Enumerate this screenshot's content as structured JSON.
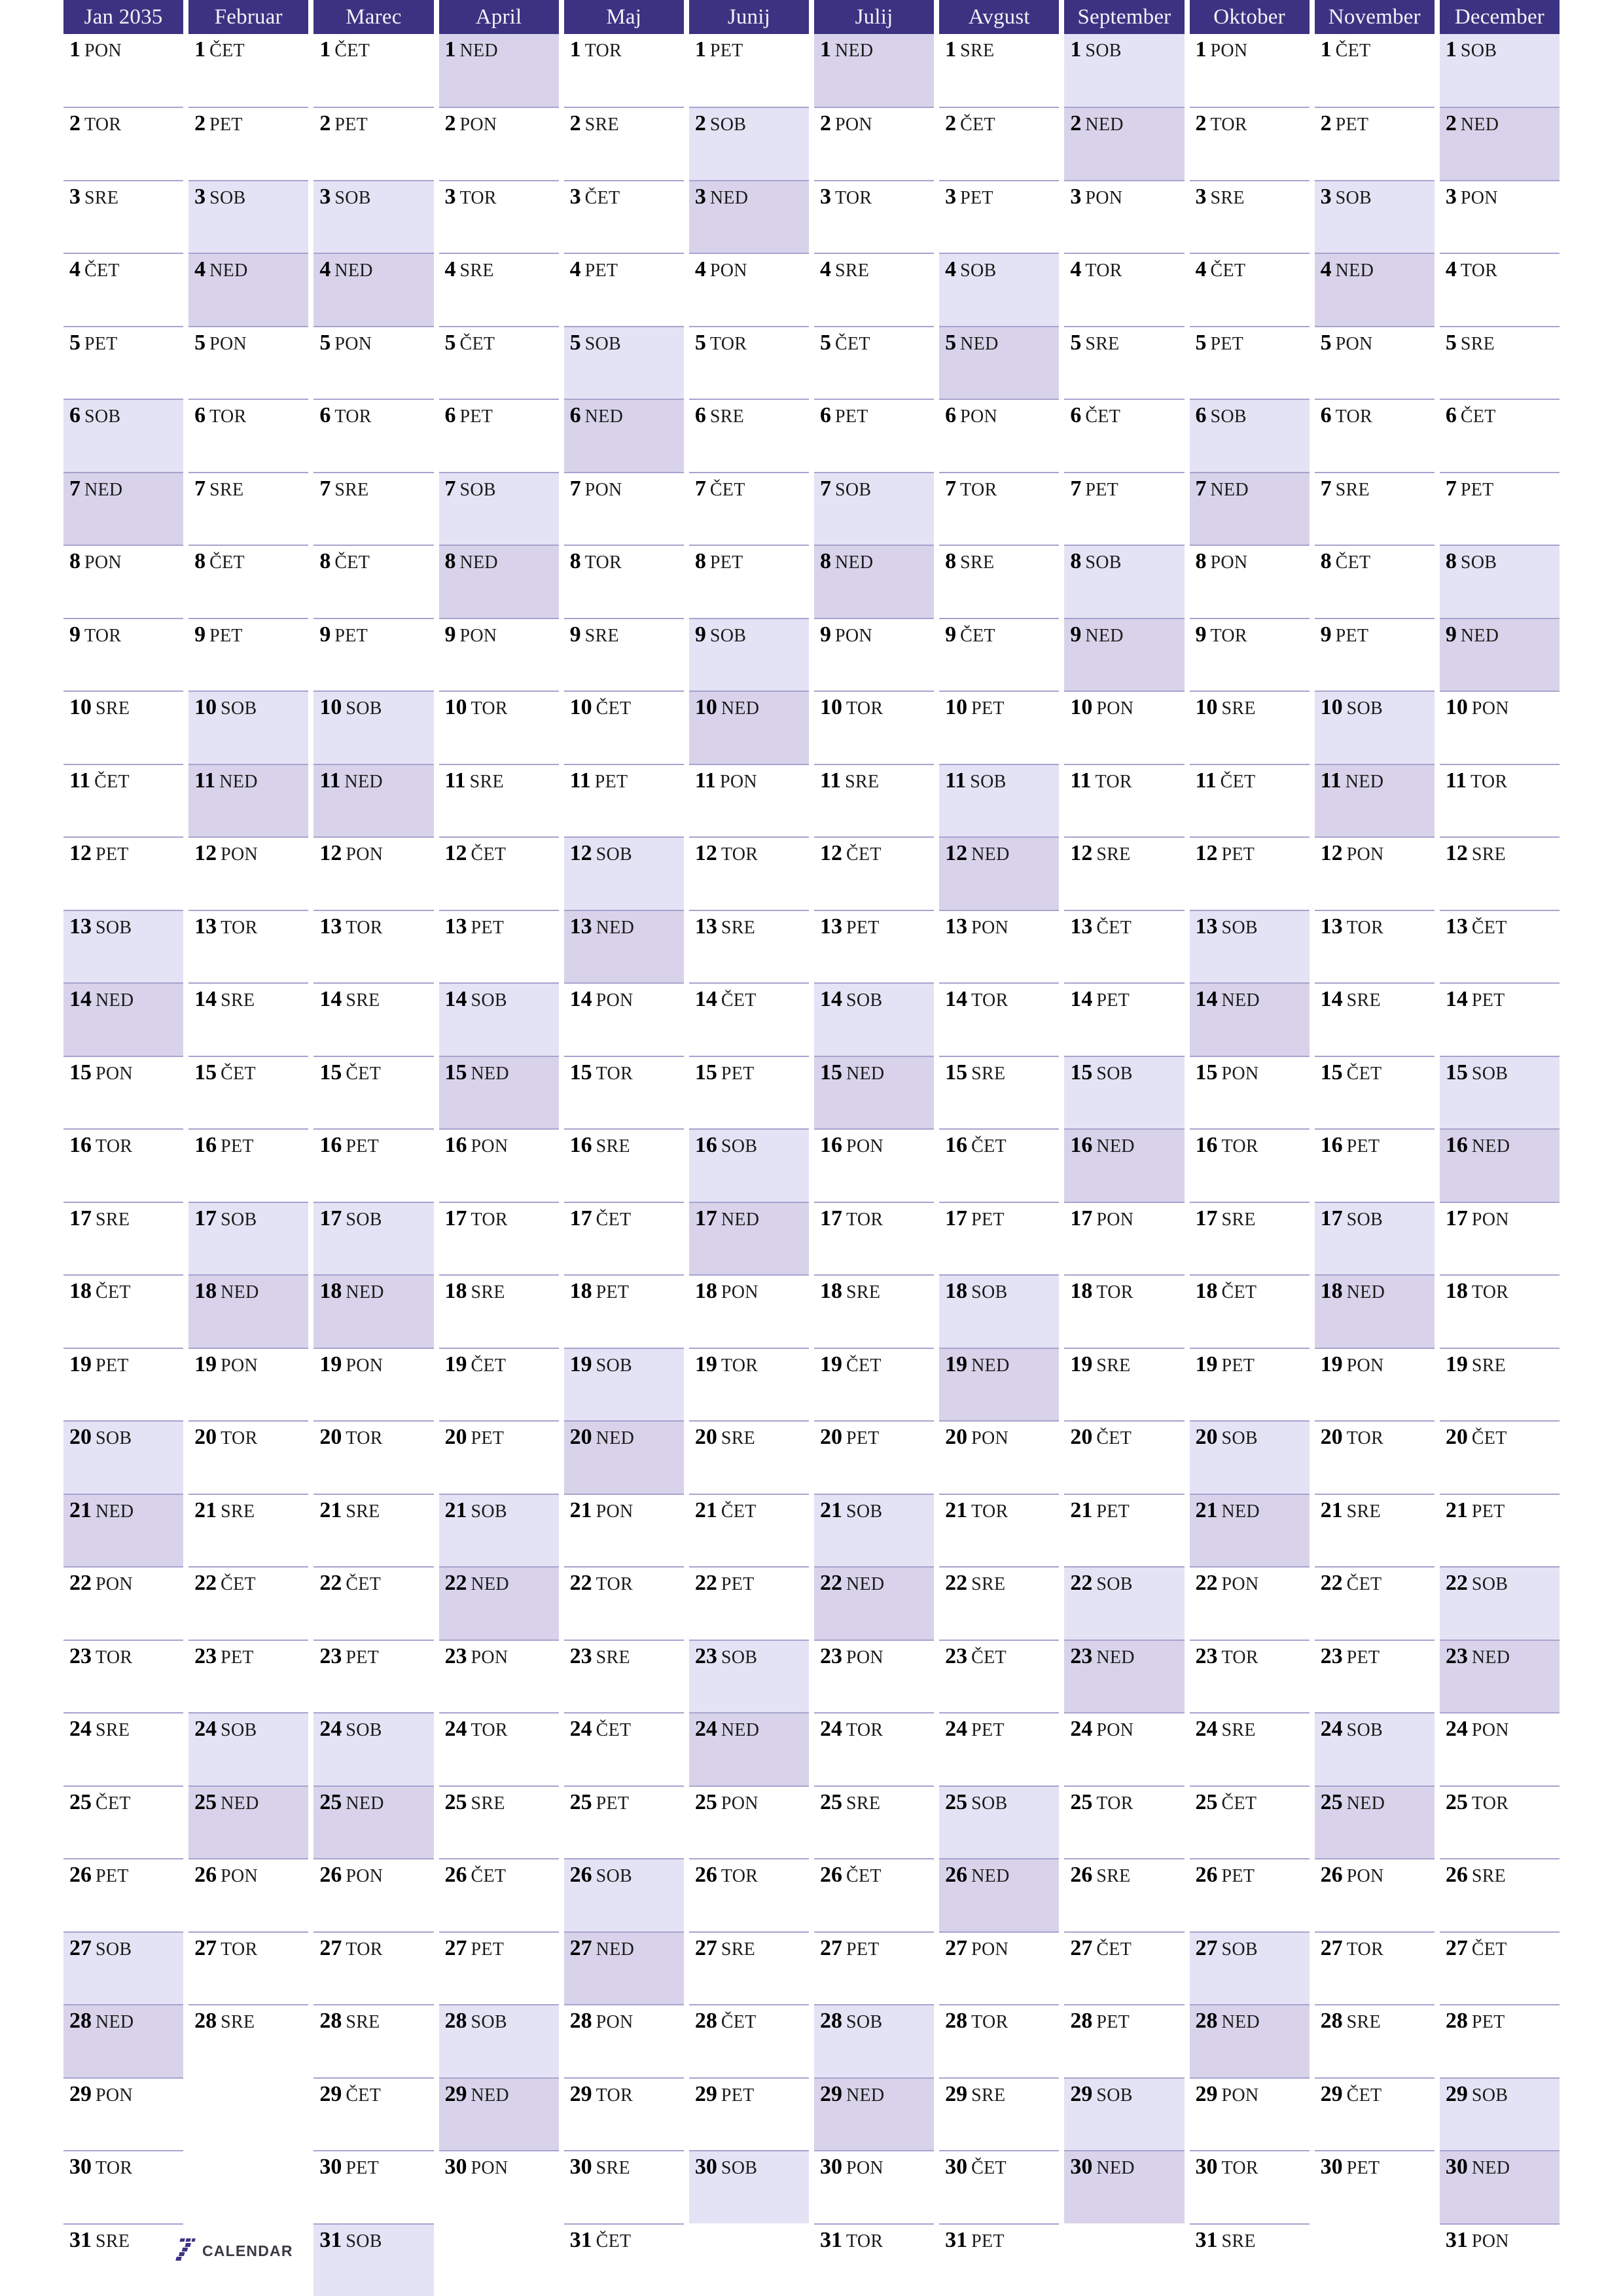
{
  "document": {
    "kind": "yearly-wall-planner",
    "year": "2035",
    "language": "Slovenian"
  },
  "colors": {
    "header_background": "#3b3382",
    "header_text": "#f2f2f8",
    "saturday_background": "#e3e3f5",
    "sunday_background": "#d8d3ea",
    "row_divider": "#a7a3cf",
    "page_background": "#ffffff",
    "day_number_text": "#000000",
    "weekday_text": "#1a1a1a",
    "logo_mark": "#3b3382",
    "logo_word": "#3a3a44"
  },
  "weekday_abbreviations": {
    "monday": "PON",
    "tuesday": "TOR",
    "wednesday": "SRE",
    "thursday": "ČET",
    "friday": "PET",
    "saturday": "SOB",
    "sunday": "NED"
  },
  "logo": {
    "mark_name": "seven-logo-icon",
    "word": "CALENDAR"
  },
  "months": [
    {
      "name": "Jan 2035",
      "index": 1,
      "days": 31,
      "first_weekday": "PON",
      "weekdays": [
        "PON",
        "TOR",
        "SRE",
        "ČET",
        "PET",
        "SOB",
        "NED",
        "PON",
        "TOR",
        "SRE",
        "ČET",
        "PET",
        "SOB",
        "NED",
        "PON",
        "TOR",
        "SRE",
        "ČET",
        "PET",
        "SOB",
        "NED",
        "PON",
        "TOR",
        "SRE",
        "ČET",
        "PET",
        "SOB",
        "NED",
        "PON",
        "TOR",
        "SRE"
      ]
    },
    {
      "name": "Februar",
      "index": 2,
      "days": 28,
      "first_weekday": "ČET",
      "weekdays": [
        "ČET",
        "PET",
        "SOB",
        "NED",
        "PON",
        "TOR",
        "SRE",
        "ČET",
        "PET",
        "SOB",
        "NED",
        "PON",
        "TOR",
        "SRE",
        "ČET",
        "PET",
        "SOB",
        "NED",
        "PON",
        "TOR",
        "SRE",
        "ČET",
        "PET",
        "SOB",
        "NED",
        "PON",
        "TOR",
        "SRE"
      ]
    },
    {
      "name": "Marec",
      "index": 3,
      "days": 31,
      "first_weekday": "ČET",
      "weekdays": [
        "ČET",
        "PET",
        "SOB",
        "NED",
        "PON",
        "TOR",
        "SRE",
        "ČET",
        "PET",
        "SOB",
        "NED",
        "PON",
        "TOR",
        "SRE",
        "ČET",
        "PET",
        "SOB",
        "NED",
        "PON",
        "TOR",
        "SRE",
        "ČET",
        "PET",
        "SOB",
        "NED",
        "PON",
        "TOR",
        "SRE",
        "ČET",
        "PET",
        "SOB"
      ]
    },
    {
      "name": "April",
      "index": 4,
      "days": 30,
      "first_weekday": "NED",
      "weekdays": [
        "NED",
        "PON",
        "TOR",
        "SRE",
        "ČET",
        "PET",
        "SOB",
        "NED",
        "PON",
        "TOR",
        "SRE",
        "ČET",
        "PET",
        "SOB",
        "NED",
        "PON",
        "TOR",
        "SRE",
        "ČET",
        "PET",
        "SOB",
        "NED",
        "PON",
        "TOR",
        "SRE",
        "ČET",
        "PET",
        "SOB",
        "NED",
        "PON"
      ]
    },
    {
      "name": "Maj",
      "index": 5,
      "days": 31,
      "first_weekday": "TOR",
      "weekdays": [
        "TOR",
        "SRE",
        "ČET",
        "PET",
        "SOB",
        "NED",
        "PON",
        "TOR",
        "SRE",
        "ČET",
        "PET",
        "SOB",
        "NED",
        "PON",
        "TOR",
        "SRE",
        "ČET",
        "PET",
        "SOB",
        "NED",
        "PON",
        "TOR",
        "SRE",
        "ČET",
        "PET",
        "SOB",
        "NED",
        "PON",
        "TOR",
        "SRE",
        "ČET"
      ]
    },
    {
      "name": "Junij",
      "index": 6,
      "days": 30,
      "first_weekday": "PET",
      "weekdays": [
        "PET",
        "SOB",
        "NED",
        "PON",
        "TOR",
        "SRE",
        "ČET",
        "PET",
        "SOB",
        "NED",
        "PON",
        "TOR",
        "SRE",
        "ČET",
        "PET",
        "SOB",
        "NED",
        "PON",
        "TOR",
        "SRE",
        "ČET",
        "PET",
        "SOB",
        "NED",
        "PON",
        "TOR",
        "SRE",
        "ČET",
        "PET",
        "SOB"
      ]
    },
    {
      "name": "Julij",
      "index": 7,
      "days": 31,
      "first_weekday": "NED",
      "weekdays": [
        "NED",
        "PON",
        "TOR",
        "SRE",
        "ČET",
        "PET",
        "SOB",
        "NED",
        "PON",
        "TOR",
        "SRE",
        "ČET",
        "PET",
        "SOB",
        "NED",
        "PON",
        "TOR",
        "SRE",
        "ČET",
        "PET",
        "SOB",
        "NED",
        "PON",
        "TOR",
        "SRE",
        "ČET",
        "PET",
        "SOB",
        "NED",
        "PON",
        "TOR"
      ]
    },
    {
      "name": "Avgust",
      "index": 8,
      "days": 31,
      "first_weekday": "SRE",
      "weekdays": [
        "SRE",
        "ČET",
        "PET",
        "SOB",
        "NED",
        "PON",
        "TOR",
        "SRE",
        "ČET",
        "PET",
        "SOB",
        "NED",
        "PON",
        "TOR",
        "SRE",
        "ČET",
        "PET",
        "SOB",
        "NED",
        "PON",
        "TOR",
        "SRE",
        "ČET",
        "PET",
        "SOB",
        "NED",
        "PON",
        "TOR",
        "SRE",
        "ČET",
        "PET"
      ]
    },
    {
      "name": "September",
      "index": 9,
      "days": 30,
      "first_weekday": "SOB",
      "weekdays": [
        "SOB",
        "NED",
        "PON",
        "TOR",
        "SRE",
        "ČET",
        "PET",
        "SOB",
        "NED",
        "PON",
        "TOR",
        "SRE",
        "ČET",
        "PET",
        "SOB",
        "NED",
        "PON",
        "TOR",
        "SRE",
        "ČET",
        "PET",
        "SOB",
        "NED",
        "PON",
        "TOR",
        "SRE",
        "ČET",
        "PET",
        "SOB",
        "NED"
      ]
    },
    {
      "name": "Oktober",
      "index": 10,
      "days": 31,
      "first_weekday": "PON",
      "weekdays": [
        "PON",
        "TOR",
        "SRE",
        "ČET",
        "PET",
        "SOB",
        "NED",
        "PON",
        "TOR",
        "SRE",
        "ČET",
        "PET",
        "SOB",
        "NED",
        "PON",
        "TOR",
        "SRE",
        "ČET",
        "PET",
        "SOB",
        "NED",
        "PON",
        "TOR",
        "SRE",
        "ČET",
        "PET",
        "SOB",
        "NED",
        "PON",
        "TOR",
        "SRE"
      ]
    },
    {
      "name": "November",
      "index": 11,
      "days": 30,
      "first_weekday": "ČET",
      "weekdays": [
        "ČET",
        "PET",
        "SOB",
        "NED",
        "PON",
        "TOR",
        "SRE",
        "ČET",
        "PET",
        "SOB",
        "NED",
        "PON",
        "TOR",
        "SRE",
        "ČET",
        "PET",
        "SOB",
        "NED",
        "PON",
        "TOR",
        "SRE",
        "ČET",
        "PET",
        "SOB",
        "NED",
        "PON",
        "TOR",
        "SRE",
        "ČET",
        "PET"
      ]
    },
    {
      "name": "December",
      "index": 12,
      "days": 31,
      "first_weekday": "SOB",
      "weekdays": [
        "SOB",
        "NED",
        "PON",
        "TOR",
        "SRE",
        "ČET",
        "PET",
        "SOB",
        "NED",
        "PON",
        "TOR",
        "SRE",
        "ČET",
        "PET",
        "SOB",
        "NED",
        "PON",
        "TOR",
        "SRE",
        "ČET",
        "PET",
        "SOB",
        "NED",
        "PON",
        "TOR",
        "SRE",
        "ČET",
        "PET",
        "SOB",
        "NED",
        "PON"
      ]
    }
  ]
}
